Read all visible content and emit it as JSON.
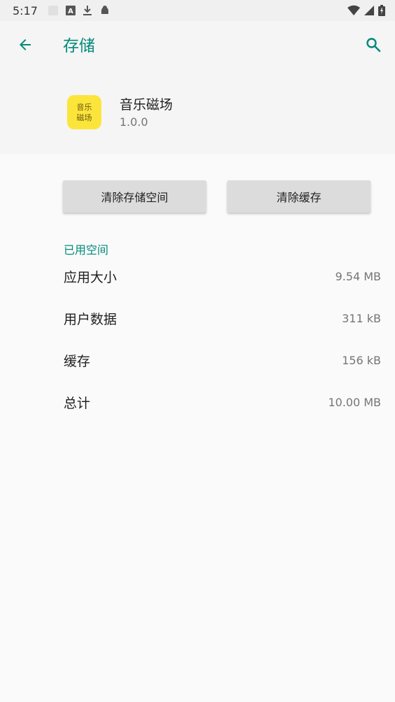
{
  "status_bar": {
    "time": "5:17",
    "icons": [
      "square-notification-icon",
      "font-a-icon",
      "download-icon",
      "android-debug-icon",
      "wifi-icon",
      "signal-icon",
      "battery-icon"
    ]
  },
  "toolbar": {
    "title": "存储",
    "back_icon": "arrow-back-icon",
    "search_icon": "search-icon"
  },
  "app": {
    "icon_text_line1": "音乐",
    "icon_text_line2": "磁场",
    "name": "音乐磁场",
    "version": "1.0.0"
  },
  "buttons": {
    "clear_storage": "清除存储空间",
    "clear_cache": "清除缓存"
  },
  "storage": {
    "section_title": "已用空间",
    "rows": [
      {
        "label": "应用大小",
        "value": "9.54 MB"
      },
      {
        "label": "用户数据",
        "value": "311 kB"
      },
      {
        "label": "缓存",
        "value": "156 kB"
      },
      {
        "label": "总计",
        "value": "10.00 MB"
      }
    ]
  },
  "colors": {
    "accent": "#00897b",
    "app_icon_bg": "#fce53a",
    "button_bg": "#dcdcdc",
    "header_bg": "#f5f5f5"
  }
}
